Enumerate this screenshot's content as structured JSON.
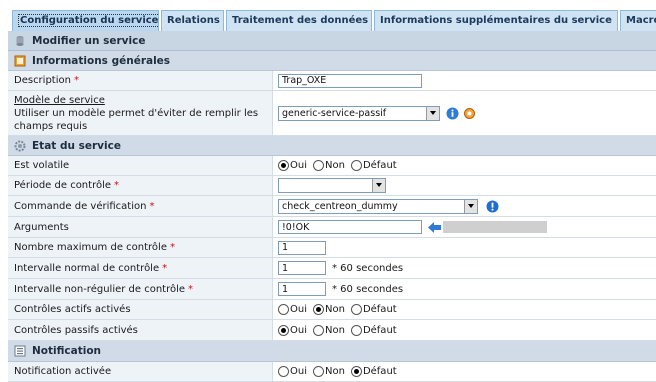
{
  "tabs": [
    {
      "label": "Configuration du service",
      "active": true
    },
    {
      "label": "Relations",
      "active": false
    },
    {
      "label": "Traitement des données",
      "active": false
    },
    {
      "label": "Informations supplémentaires du service",
      "active": false
    },
    {
      "label": "Macro",
      "active": false
    }
  ],
  "form": {
    "title": "Modifier un service",
    "general_section": "Informations générales",
    "description": {
      "label": "Description",
      "value": "Trap_OXE"
    },
    "template": {
      "label": "Modèle de service",
      "help": "Utiliser un modèle permet d'éviter de remplir les champs requis",
      "value": "generic-service-passif"
    },
    "state_section": "Etat du service",
    "volatile": {
      "label": "Est volatile",
      "options": [
        "Oui",
        "Non",
        "Défaut"
      ],
      "selected": "Oui"
    },
    "check_period": {
      "label": "Période de contrôle",
      "value": ""
    },
    "check_command": {
      "label": "Commande de vérification",
      "value": "check_centreon_dummy"
    },
    "arguments": {
      "label": "Arguments",
      "value": "!0!OK"
    },
    "max_checks": {
      "label": "Nombre maximum de contrôle",
      "value": "1"
    },
    "normal_interval": {
      "label": "Intervalle normal de contrôle",
      "value": "1",
      "unit": "* 60 secondes"
    },
    "retry_interval": {
      "label": "Intervalle non-régulier de contrôle",
      "value": "1",
      "unit": "* 60 secondes"
    },
    "active_checks": {
      "label": "Contrôles actifs activés",
      "options": [
        "Oui",
        "Non",
        "Défaut"
      ],
      "selected": "Non"
    },
    "passive_checks": {
      "label": "Contrôles passifs activés",
      "options": [
        "Oui",
        "Non",
        "Défaut"
      ],
      "selected": "Oui"
    },
    "notification_section": "Notification",
    "notification_enabled": {
      "label": "Notification activée",
      "options": [
        "Oui",
        "Non",
        "Défaut"
      ],
      "selected": "Défaut"
    }
  },
  "required_mark": "*",
  "colors": {
    "tab_bg": "#cfe3f3",
    "header_bg": "#d0dbe7",
    "label_bg": "#eef3f8",
    "info_blue": "#1f6fd1",
    "arrow_blue": "#2f7ad6"
  },
  "icons": {
    "header": "database-icon",
    "general": "book-icon",
    "state": "gear-icon",
    "notification": "list-icon",
    "template_info": "info-icon",
    "template_settings": "settings-icon",
    "command_info": "info-icon",
    "arguments_arrow": "arrow-left-icon"
  }
}
